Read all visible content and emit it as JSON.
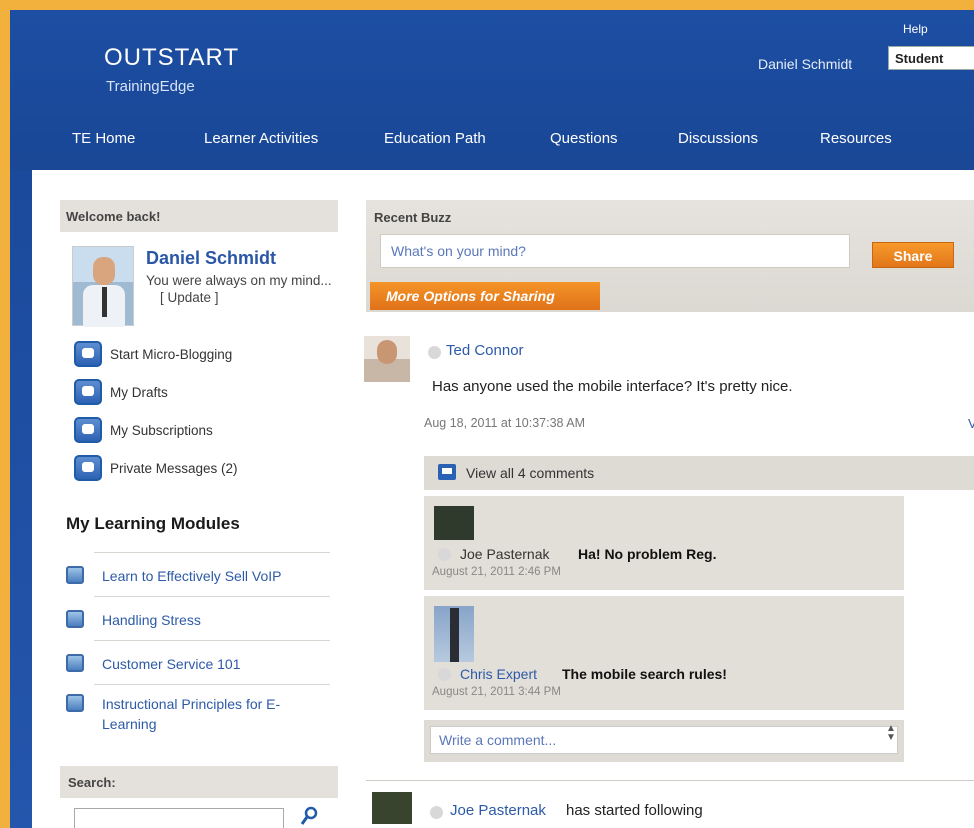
{
  "header": {
    "logo": "OUTSTART",
    "logo_sub": "TrainingEdge",
    "help": "Help",
    "user_name": "Daniel Schmidt",
    "role": "Student"
  },
  "nav": [
    "TE Home",
    "Learner Activities",
    "Education Path",
    "Questions",
    "Discussions",
    "Resources"
  ],
  "sidebar": {
    "welcome_title": "Welcome back!",
    "profile": {
      "name": "Daniel Schmidt",
      "status": "You were always on my mind...",
      "update": "[ Update ]"
    },
    "menu": [
      {
        "label": "Start Micro-Blogging",
        "icon": "microblog-icon"
      },
      {
        "label": "My Drafts",
        "icon": "drafts-icon"
      },
      {
        "label": "My Subscriptions",
        "icon": "subscriptions-icon"
      },
      {
        "label": "Private Messages (2)",
        "icon": "messages-icon"
      }
    ],
    "modules_title": "My Learning Modules",
    "modules": [
      "Learn to Effectively Sell VoIP",
      "Handling Stress",
      "Customer Service 101",
      "Instructional Principles for E-Learning"
    ],
    "search_title": "Search:",
    "search_value": ""
  },
  "buzz": {
    "title": "Recent Buzz",
    "placeholder": "What's on your mind?",
    "share": "Share",
    "more_options": "More Options for Sharing"
  },
  "post": {
    "author": "Ted Connor",
    "text": "Has anyone used the mobile interface? It's pretty nice.",
    "time": "Aug 18, 2011 at 10:37:38 AM",
    "view_link": "V",
    "view_comments": "View all 4 comments",
    "comments": [
      {
        "author": "Joe Pasternak",
        "text": "Ha! No problem Reg.",
        "time": "August 21, 2011 2:46 PM"
      },
      {
        "author": "Chris Expert",
        "text": "The mobile search rules!",
        "time": "August 21, 2011 3:44 PM"
      }
    ],
    "write_placeholder": "Write a comment..."
  },
  "activity": {
    "author": "Joe Pasternak",
    "action": "has started following"
  },
  "colors": {
    "header_blue": "#1c4ea3",
    "frame_orange": "#f2b03d",
    "accent_orange": "#f0861f",
    "link_blue": "#2d5aa8"
  }
}
